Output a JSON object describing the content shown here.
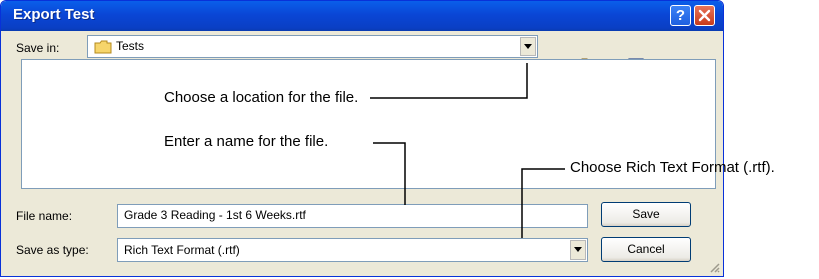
{
  "window": {
    "title": "Export Test"
  },
  "save_in": {
    "label": "Save in:",
    "value": "Tests"
  },
  "toolbar": {
    "icons": [
      "back-arrow-icon",
      "up-folder-icon",
      "new-folder-icon",
      "views-menu-icon"
    ]
  },
  "file_name": {
    "label": "File name:",
    "value": "Grade 3 Reading - 1st 6 Weeks.rtf"
  },
  "save_as_type": {
    "label": "Save as type:",
    "value": "Rich Text Format (.rtf)"
  },
  "buttons": {
    "save": "Save",
    "cancel": "Cancel"
  },
  "annotations": {
    "location": "Choose a location for the file.",
    "name": "Enter a name for the file.",
    "format": "Choose Rich Text Format (.rtf)."
  },
  "colors": {
    "titlebar": "#0A46D6",
    "dialog_bg": "#ECE9D8",
    "close": "#C83A1A"
  }
}
